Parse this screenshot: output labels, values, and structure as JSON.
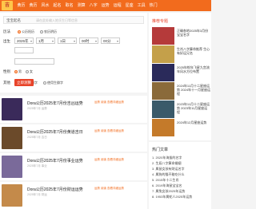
{
  "nav": [
    "黄历",
    "黄历",
    "风水",
    "起名",
    "取名",
    "测算",
    "八字",
    "运势",
    "运程",
    "星座",
    "工具",
    "热门"
  ],
  "search": {
    "tag": "宝宝起名",
    "placeholder": "请在此处输入姓氏生日等信息"
  },
  "form": {
    "calendar_label": "历法",
    "calendar_options": [
      "公历阳历",
      "农历阴历"
    ],
    "date_label": "出生",
    "year": "2025年",
    "month": "1月",
    "day": "1日",
    "hour": "00时",
    "minute": "00分",
    "gender_label": "性别",
    "gender_options": [
      "男",
      "女"
    ],
    "extra_label": "其他",
    "extra_options": [
      "不使用生僻字",
      "使用生僻字"
    ],
    "submit": "立即测算"
  },
  "articles": [
    {
      "title": "Dora公历2025年7月份吉凶运势",
      "meta": "2025年7月 运势",
      "links": "运势 阅读 查看详细运势",
      "color": "#3a2a5a"
    },
    {
      "title": "Dora公历2025年7月份黄道吉日",
      "meta": "2025年7月 吉日",
      "links": "运势 阅读 查看详细运势",
      "color": "#6b4a2a"
    },
    {
      "title": "Dora公历2025年7月份事业运势",
      "meta": "2025年7月 事业",
      "links": "运势 阅读 查看详细运势",
      "color": "#7a6a9a"
    },
    {
      "title": "Dora公历2025年7月份财运运势",
      "meta": "2025年7月 财运",
      "links": "运势 阅读 查看详细运势",
      "color": "#c48a4a"
    }
  ],
  "side": {
    "heading": "推荐专题",
    "items": [
      {
        "text": "正确各地2025年3月份宝宝名字",
        "color": "#b53a3a"
      },
      {
        "text": "生肖八字算命推荐 生心有好运兄名",
        "color": "#c4a04a"
      },
      {
        "text": "2025年蛇年飞星九宫流年风水方位布置",
        "color": "#2a2a5a"
      },
      {
        "text": "2024年11月十二星座运势 2024年十一月星座运程",
        "color": "#8a6a3a"
      },
      {
        "text": "2023年11月十二星座运势 2023年11月星座运程",
        "color": "#3a5a6a"
      },
      {
        "text": "2024年12月星座运势",
        "color": "#c47a2a"
      }
    ]
  },
  "hot": {
    "heading": "热门文章",
    "items": [
      "1. 2020年海拔的名字",
      "2. 生辰八字算命婚姻",
      "3. 属鼠女孩有财运名字",
      "4. 属狗的猫不能吃什么",
      "5. 2015年十二生肖",
      "6. 2019年海鼠宝宝名",
      "7. 属兔女孩2025年运势",
      "8. 1953年属蛇人2025年运势"
    ]
  }
}
